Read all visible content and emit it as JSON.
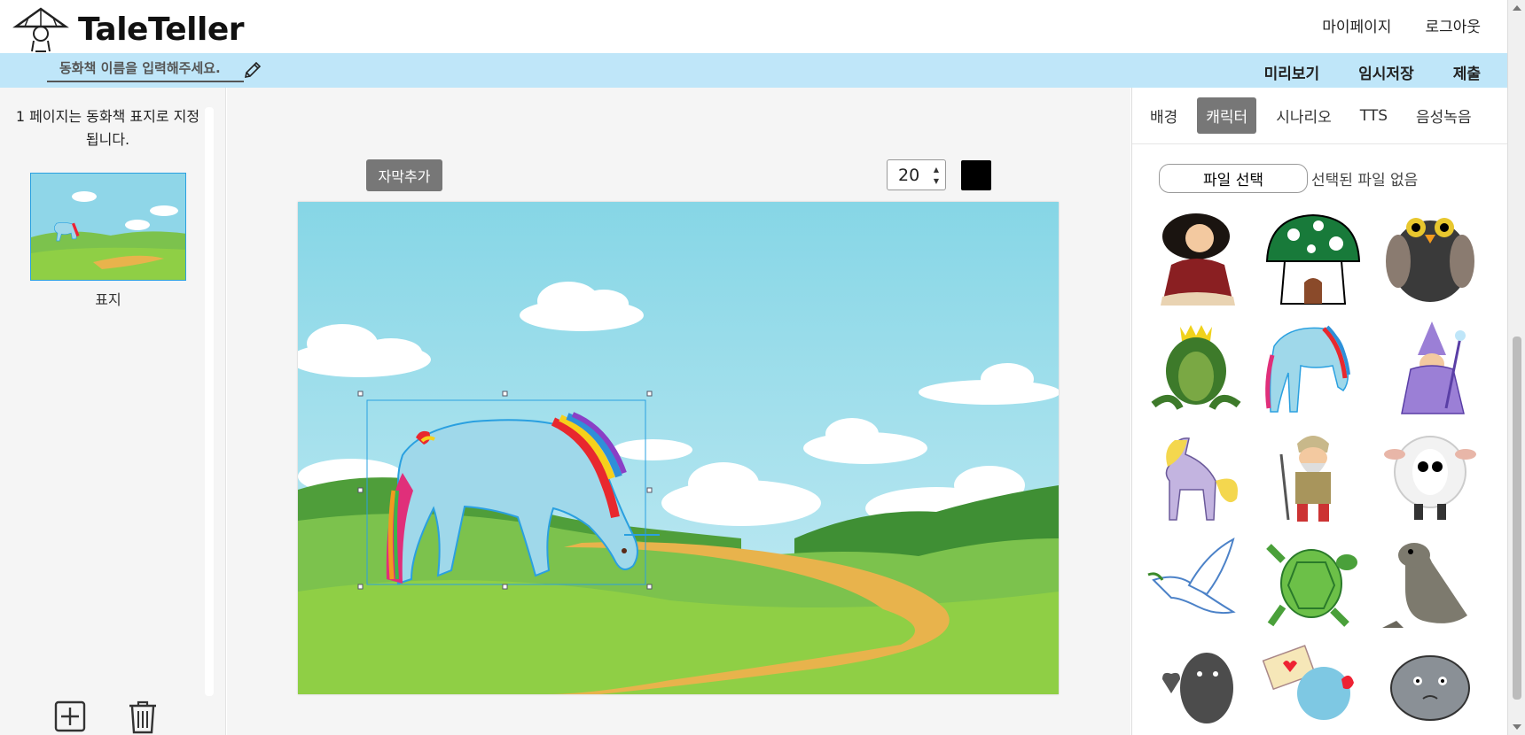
{
  "header": {
    "logo_text": "TaleTeller",
    "links": [
      "마이페이지",
      "로그아웃"
    ]
  },
  "titlebar": {
    "placeholder": "동화책 이름을 입력해주세요.",
    "actions": [
      "미리보기",
      "임시저장",
      "제출"
    ]
  },
  "left": {
    "note": "1 페이지는 동화책 표지로 지정됩니다.",
    "thumb_label": "표지"
  },
  "editor": {
    "add_subtitle_label": "자막추가",
    "font_size": "20",
    "text_color": "#000000"
  },
  "right": {
    "tabs": [
      "배경",
      "캐릭터",
      "시나리오",
      "TTS",
      "음성녹음"
    ],
    "active_tab": "캐릭터",
    "file_button": "파일 선택",
    "file_status": "선택된 파일 없음",
    "characters": [
      "princess-icon",
      "mushroom-house-icon",
      "owl-icon",
      "frog-prince-icon",
      "unicorn-icon",
      "wizard-icon",
      "pony-icon",
      "dwarf-icon",
      "sheep-icon",
      "dove-icon",
      "turtle-icon",
      "seal-icon",
      "seal-heart-icon",
      "letter-bird-icon",
      "elephant-icon"
    ]
  },
  "colors": {
    "titlebar": "#bfe6f9",
    "active_tab": "#777777",
    "selection": "#2aa0e0"
  }
}
